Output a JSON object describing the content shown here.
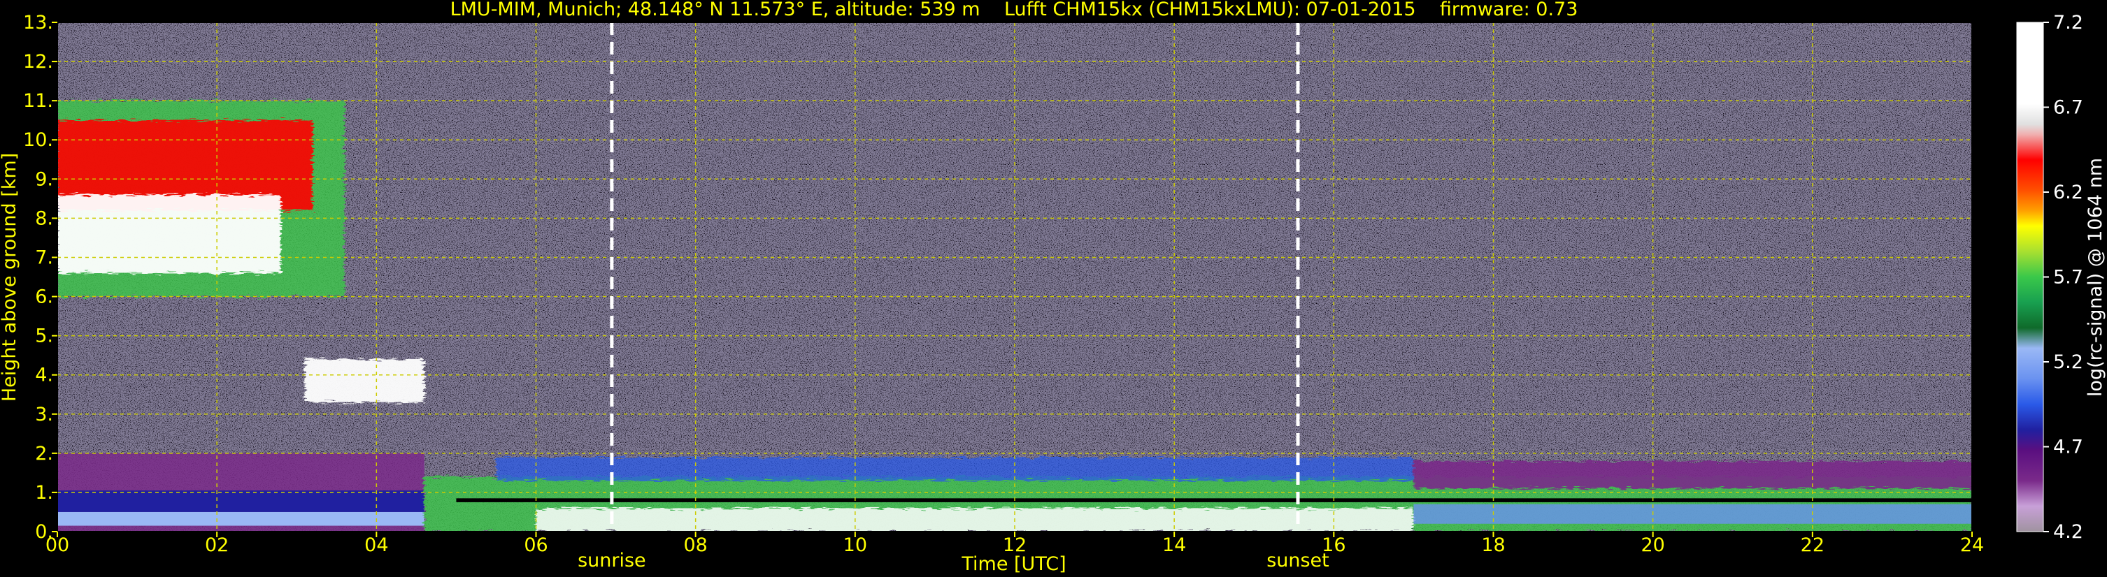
{
  "chart_data": {
    "type": "heatmap",
    "title": "LMU-MIM, Munich; 48.148° N 11.573° E, altitude: 539 m    Lufft CHM15kx (CHM15kxLMU): 07-01-2015    firmware: 0.73",
    "xlabel": "Time [UTC]",
    "ylabel": "Height above ground [km]",
    "xlim": [
      0,
      24
    ],
    "ylim": [
      0,
      13
    ],
    "x_tick_labels": [
      "00",
      "02",
      "04",
      "06",
      "08",
      "10",
      "12",
      "14",
      "16",
      "18",
      "20",
      "22",
      "24"
    ],
    "y_tick_labels": [
      "0.",
      "1.",
      "2.",
      "3.",
      "4.",
      "5.",
      "6.",
      "7.",
      "8.",
      "9.",
      "10.",
      "11.",
      "12.",
      "13."
    ],
    "grid": true,
    "annotations": [
      {
        "label": "sunrise",
        "x": 6.95,
        "style": "white dashed vertical line"
      },
      {
        "label": "sunset",
        "x": 15.55,
        "style": "white dashed vertical line"
      }
    ],
    "colorbar": {
      "label": "log(rc-signal) @ 1064 nm",
      "range": [
        4.2,
        7.2
      ],
      "tick_labels": [
        "4.2",
        "4.7",
        "5.2",
        "5.7",
        "6.2",
        "6.7",
        "7.2"
      ]
    },
    "features": [
      {
        "label": "cirrus cloud",
        "x_range": [
          0,
          3.6
        ],
        "height_range_km": [
          6,
          11
        ]
      },
      {
        "label": "mid-level cloud",
        "x_range": [
          3.1,
          4.6
        ],
        "height_range_km": [
          3.2,
          4.8
        ]
      },
      {
        "label": "boundary layer",
        "x_range": [
          0,
          24
        ],
        "height_range_km": [
          0,
          2
        ]
      }
    ]
  },
  "colors": {
    "text": "#ffff00",
    "background": "#000000",
    "grid": "#cccc00",
    "colormap": [
      "#a093a0",
      "#c8a0d8",
      "#7a2a8a",
      "#5a0f80",
      "#2020a0",
      "#2a5ae8",
      "#6a92f0",
      "#9ab8f5",
      "#0f6a2a",
      "#18a050",
      "#3ac84a",
      "#a8e030",
      "#ffff00",
      "#ffa000",
      "#ff5000",
      "#ff0000",
      "#f0b0b0",
      "#e0e0e0",
      "#ffffff"
    ]
  }
}
